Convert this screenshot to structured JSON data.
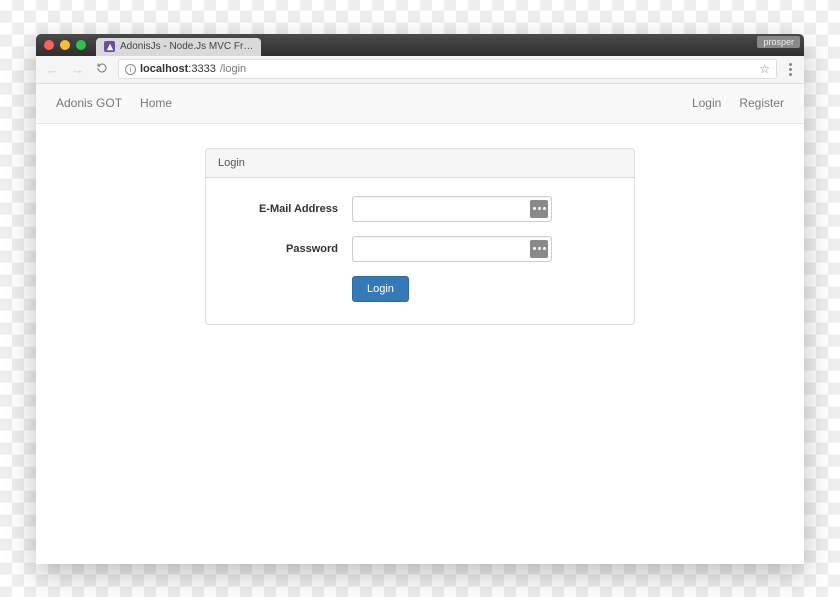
{
  "browser": {
    "profile_badge": "prosper",
    "tab": {
      "title": "AdonisJs - Node.Js MVC Fr…"
    },
    "address": {
      "host": "localhost",
      "port": ":3333",
      "path": "/login"
    }
  },
  "navbar": {
    "brand": "Adonis GOT",
    "home": "Home",
    "login": "Login",
    "register": "Register"
  },
  "panel": {
    "title": "Login",
    "email_label": "E-Mail Address",
    "password_label": "Password",
    "submit_label": "Login"
  }
}
